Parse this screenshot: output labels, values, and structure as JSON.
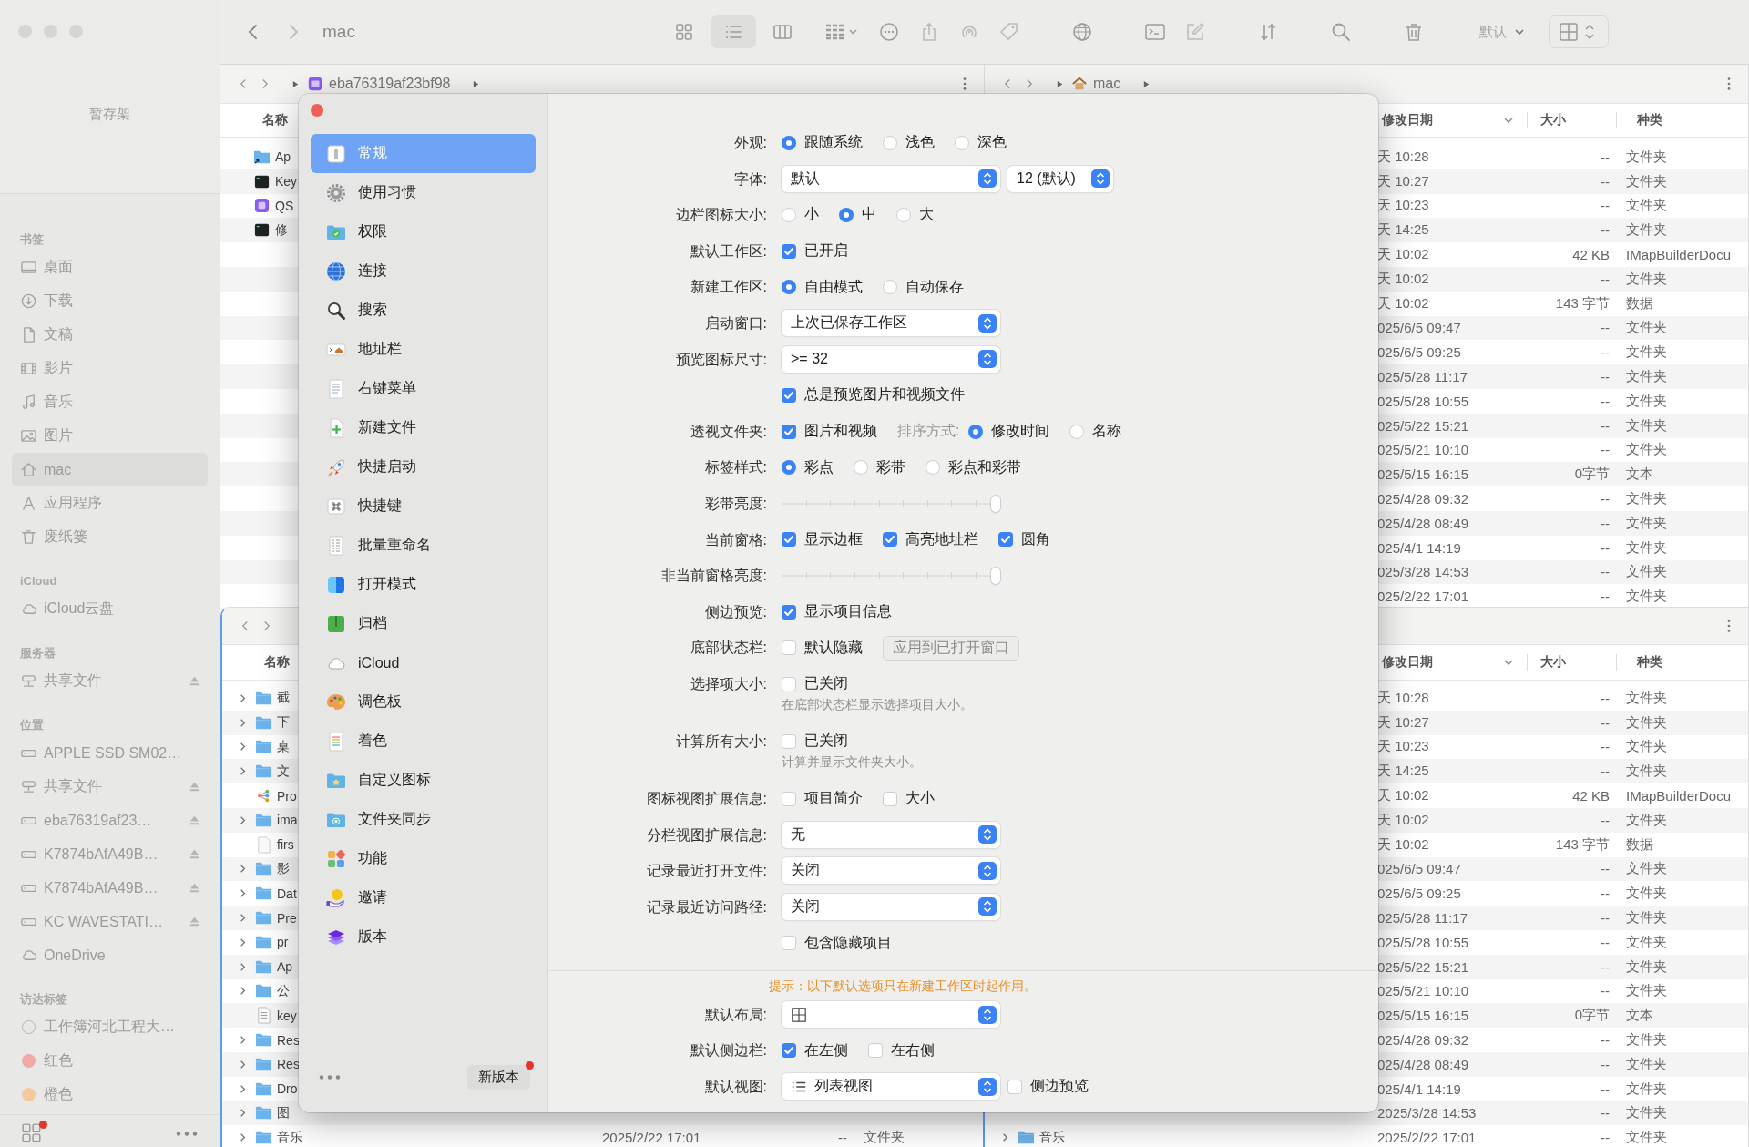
{
  "toolbar": {
    "title": "mac",
    "views": [
      {
        "kind": "icons",
        "selected": false
      },
      {
        "kind": "list",
        "selected": true
      },
      {
        "kind": "columns",
        "selected": false
      }
    ],
    "sort_label": "默认"
  },
  "sidebar": {
    "shelf": "暂存架",
    "badge": true,
    "sections": [
      {
        "title": "书签",
        "items": [
          {
            "label": "桌面",
            "kind": "desktop",
            "selected": false,
            "eject": false
          },
          {
            "label": "下载",
            "kind": "download",
            "selected": false,
            "eject": false
          },
          {
            "label": "文稿",
            "kind": "doc",
            "selected": false,
            "eject": false
          },
          {
            "label": "影片",
            "kind": "film",
            "selected": false,
            "eject": false
          },
          {
            "label": "音乐",
            "kind": "music",
            "selected": false,
            "eject": false
          },
          {
            "label": "图片",
            "kind": "picture",
            "selected": false,
            "eject": false
          },
          {
            "label": "mac",
            "kind": "home",
            "selected": true,
            "eject": false
          },
          {
            "label": "应用程序",
            "kind": "apps",
            "selected": false,
            "eject": false
          },
          {
            "label": "废纸篓",
            "kind": "trash",
            "selected": false,
            "eject": false
          }
        ]
      },
      {
        "title": "iCloud",
        "items": [
          {
            "label": "iCloud云盘",
            "kind": "cloud",
            "selected": false,
            "eject": false
          }
        ]
      },
      {
        "title": "服务器",
        "items": [
          {
            "label": "共享文件",
            "kind": "server",
            "selected": false,
            "eject": true
          }
        ]
      },
      {
        "title": "位置",
        "items": [
          {
            "label": "APPLE SSD SM02…",
            "kind": "drive",
            "selected": false,
            "eject": false
          },
          {
            "label": "共享文件",
            "kind": "server",
            "selected": false,
            "eject": true
          },
          {
            "label": "eba76319af23…",
            "kind": "drive",
            "selected": false,
            "eject": true
          },
          {
            "label": "K7874bAfA49B…",
            "kind": "drive",
            "selected": false,
            "eject": true
          },
          {
            "label": "K7874bAfA49B…",
            "kind": "drive",
            "selected": false,
            "eject": true
          },
          {
            "label": "KC WAVESTATI…",
            "kind": "drive",
            "selected": false,
            "eject": true
          },
          {
            "label": "OneDrive",
            "kind": "cloud",
            "selected": false,
            "eject": false
          }
        ]
      },
      {
        "title": "访达标签",
        "items": [
          {
            "label": "工作簿河北工程大…",
            "kind": "tag-empty",
            "selected": false,
            "eject": false
          },
          {
            "label": "红色",
            "kind": "tag",
            "color": "#f0a9a5",
            "selected": false,
            "eject": false
          },
          {
            "label": "橙色",
            "kind": "tag",
            "color": "#f5c9a0",
            "selected": false,
            "eject": false
          }
        ]
      }
    ]
  },
  "panes": [
    {
      "active": false,
      "path": {
        "kind": "app",
        "label": "eba76319af23bf98"
      },
      "columns": [
        "名称"
      ],
      "rows": [
        {
          "name": "Ap",
          "kind": "folder-alias",
          "expandable": false
        },
        {
          "name": "Key",
          "kind": "terminal",
          "expandable": false
        },
        {
          "name": "QS",
          "kind": "app",
          "expandable": false
        },
        {
          "name": "修",
          "kind": "terminal",
          "expandable": false
        }
      ]
    },
    {
      "active": false,
      "path": {
        "kind": "home",
        "label": "mac"
      },
      "columns": [
        "修改日期",
        "大小",
        "种类"
      ],
      "rows": [
        {
          "date": "天 10:28",
          "size": "--",
          "type": "文件夹"
        },
        {
          "date": "天 10:27",
          "size": "--",
          "type": "文件夹"
        },
        {
          "date": "天 10:23",
          "size": "--",
          "type": "文件夹"
        },
        {
          "date": "天 14:25",
          "size": "--",
          "type": "文件夹"
        },
        {
          "date": "天 10:02",
          "size": "42 KB",
          "type": "IMapBuilderDocu"
        },
        {
          "date": "天 10:02",
          "size": "--",
          "type": "文件夹"
        },
        {
          "date": "天 10:02",
          "size": "143 字节",
          "type": "数据"
        },
        {
          "date": "025/6/5 09:47",
          "size": "--",
          "type": "文件夹"
        },
        {
          "date": "025/6/5 09:25",
          "size": "--",
          "type": "文件夹"
        },
        {
          "date": "025/5/28 11:17",
          "size": "--",
          "type": "文件夹"
        },
        {
          "date": "025/5/28 10:55",
          "size": "--",
          "type": "文件夹"
        },
        {
          "date": "025/5/22 15:21",
          "size": "--",
          "type": "文件夹"
        },
        {
          "date": "025/5/21 10:10",
          "size": "--",
          "type": "文件夹"
        },
        {
          "date": "025/5/15 16:15",
          "size": "0字节",
          "type": "文本"
        },
        {
          "date": "025/4/28 09:32",
          "size": "--",
          "type": "文件夹"
        },
        {
          "date": "025/4/28 08:49",
          "size": "--",
          "type": "文件夹"
        },
        {
          "date": "025/4/1 14:19",
          "size": "--",
          "type": "文件夹"
        },
        {
          "date": "025/3/28 14:53",
          "size": "--",
          "type": "文件夹"
        },
        {
          "date": "025/2/22 17:01",
          "size": "--",
          "type": "文件夹"
        }
      ]
    },
    {
      "active": true,
      "columns": [
        "名称"
      ],
      "rows": [
        {
          "name": "截",
          "kind": "folder",
          "expandable": true
        },
        {
          "name": "下",
          "kind": "folder",
          "expandable": true
        },
        {
          "name": "桌",
          "kind": "folder",
          "expandable": true
        },
        {
          "name": "文",
          "kind": "folder",
          "expandable": true
        },
        {
          "name": "Pro",
          "kind": "graph",
          "expandable": false
        },
        {
          "name": "ima",
          "kind": "folder",
          "expandable": true
        },
        {
          "name": "firs",
          "kind": "file",
          "expandable": false
        },
        {
          "name": "影",
          "kind": "folder",
          "expandable": true
        },
        {
          "name": "Dat",
          "kind": "folder",
          "expandable": true
        },
        {
          "name": "Pre",
          "kind": "folder",
          "expandable": true
        },
        {
          "name": "pr",
          "kind": "folder",
          "expandable": true
        },
        {
          "name": "Ap",
          "kind": "folder",
          "expandable": true
        },
        {
          "name": "公",
          "kind": "folder",
          "expandable": true
        },
        {
          "name": "key",
          "kind": "text",
          "expandable": false
        },
        {
          "name": "Res",
          "kind": "folder",
          "expandable": true
        },
        {
          "name": "Res",
          "kind": "folder",
          "expandable": true
        },
        {
          "name": "Dro",
          "kind": "folder",
          "expandable": true
        },
        {
          "name": "图",
          "kind": "folder",
          "expandable": true
        },
        {
          "name": "音乐",
          "kind": "folder",
          "expandable": true,
          "date": "2025/2/22 17:01",
          "size": "--",
          "type": "文件夹"
        }
      ]
    },
    {
      "active": false,
      "columns": [
        "修改日期",
        "大小",
        "种类"
      ],
      "rows": [
        {
          "date": "天 10:28",
          "size": "--",
          "type": "文件夹"
        },
        {
          "date": "天 10:27",
          "size": "--",
          "type": "文件夹"
        },
        {
          "date": "天 10:23",
          "size": "--",
          "type": "文件夹"
        },
        {
          "date": "天 14:25",
          "size": "--",
          "type": "文件夹"
        },
        {
          "date": "天 10:02",
          "size": "42 KB",
          "type": "IMapBuilderDocu"
        },
        {
          "date": "天 10:02",
          "size": "--",
          "type": "文件夹"
        },
        {
          "date": "天 10:02",
          "size": "143 字节",
          "type": "数据"
        },
        {
          "date": "025/6/5 09:47",
          "size": "--",
          "type": "文件夹"
        },
        {
          "date": "025/6/5 09:25",
          "size": "--",
          "type": "文件夹"
        },
        {
          "date": "025/5/28 11:17",
          "size": "--",
          "type": "文件夹"
        },
        {
          "date": "025/5/28 10:55",
          "size": "--",
          "type": "文件夹"
        },
        {
          "date": "025/5/22 15:21",
          "size": "--",
          "type": "文件夹"
        },
        {
          "date": "025/5/21 10:10",
          "size": "--",
          "type": "文件夹"
        },
        {
          "date": "025/5/15 16:15",
          "size": "0字节",
          "type": "文本"
        },
        {
          "date": "025/4/28 09:32",
          "size": "--",
          "type": "文件夹"
        },
        {
          "date": "025/4/28 08:49",
          "size": "--",
          "type": "文件夹"
        },
        {
          "date": "025/4/1 14:19",
          "size": "--",
          "type": "文件夹"
        },
        {
          "date": "2025/3/28 14:53",
          "size": "--",
          "type": "文件夹"
        },
        {
          "name": "音乐",
          "kind": "folder",
          "expandable": true,
          "date": "2025/2/22 17:01",
          "size": "--",
          "type": "文件夹"
        }
      ]
    }
  ],
  "prefs": {
    "nav": [
      {
        "label": "常规",
        "kind": "general",
        "selected": true
      },
      {
        "label": "使用习惯",
        "kind": "habits",
        "selected": false
      },
      {
        "label": "权限",
        "kind": "permission",
        "selected": false
      },
      {
        "label": "连接",
        "kind": "connect",
        "selected": false
      },
      {
        "label": "搜索",
        "kind": "search",
        "selected": false
      },
      {
        "label": "地址栏",
        "kind": "address",
        "selected": false
      },
      {
        "label": "右键菜单",
        "kind": "menu",
        "selected": false
      },
      {
        "label": "新建文件",
        "kind": "newfile",
        "selected": false
      },
      {
        "label": "快捷启动",
        "kind": "launch",
        "selected": false
      },
      {
        "label": "快捷键",
        "kind": "shortcut",
        "selected": false
      },
      {
        "label": "批量重命名",
        "kind": "rename",
        "selected": false
      },
      {
        "label": "打开模式",
        "kind": "openmode",
        "selected": false
      },
      {
        "label": "归档",
        "kind": "archive",
        "selected": false
      },
      {
        "label": "iCloud",
        "kind": "icloud",
        "selected": false
      },
      {
        "label": "调色板",
        "kind": "palette",
        "selected": false
      },
      {
        "label": "着色",
        "kind": "coloring",
        "selected": false
      },
      {
        "label": "自定义图标",
        "kind": "customicon",
        "selected": false
      },
      {
        "label": "文件夹同步",
        "kind": "sync",
        "selected": false
      },
      {
        "label": "功能",
        "kind": "features",
        "selected": false
      },
      {
        "label": "邀请",
        "kind": "invite",
        "selected": false
      },
      {
        "label": "版本",
        "kind": "version",
        "selected": false
      }
    ],
    "new_version": {
      "label": "新版本",
      "badge": true
    },
    "rows": [
      {
        "label": "外观:",
        "controls": [
          {
            "kind": "radio",
            "label": "跟随系统",
            "selected": true
          },
          {
            "kind": "radio",
            "label": "浅色",
            "selected": false
          },
          {
            "kind": "radio",
            "label": "深色",
            "selected": false
          }
        ]
      },
      {
        "label": "字体:",
        "controls": [
          {
            "kind": "select",
            "value": "默认"
          },
          {
            "kind": "small-select",
            "value": "12 (默认)"
          }
        ]
      },
      {
        "label": "边栏图标大小:",
        "controls": [
          {
            "kind": "radio",
            "label": "小",
            "selected": false
          },
          {
            "kind": "radio",
            "label": "中",
            "selected": true
          },
          {
            "kind": "radio",
            "label": "大",
            "selected": false
          }
        ]
      },
      {
        "label": "默认工作区:",
        "controls": [
          {
            "kind": "checkbox",
            "label": "已开启",
            "checked": true
          }
        ]
      },
      {
        "label": "新建工作区:",
        "controls": [
          {
            "kind": "radio",
            "label": "自由模式",
            "selected": true
          },
          {
            "kind": "radio",
            "label": "自动保存",
            "selected": false
          }
        ]
      },
      {
        "label": "启动窗口:",
        "controls": [
          {
            "kind": "select",
            "value": "上次已保存工作区"
          }
        ]
      },
      {
        "label": "预览图标尺寸:",
        "controls": [
          {
            "kind": "select",
            "value": ">= 32"
          }
        ]
      },
      {
        "controls": [
          {
            "kind": "checkbox",
            "label": "总是预览图片和视频文件",
            "checked": true
          }
        ]
      },
      {
        "label": "透视文件夹:",
        "controls": [
          {
            "kind": "checkbox",
            "label": "图片和视频",
            "checked": true
          },
          {
            "kind": "label",
            "text": "排序方式:"
          },
          {
            "kind": "radio",
            "label": "修改时间",
            "selected": true
          },
          {
            "kind": "radio",
            "label": "名称",
            "selected": false
          }
        ]
      },
      {
        "label": "标签样式:",
        "controls": [
          {
            "kind": "radio",
            "label": "彩点",
            "selected": true
          },
          {
            "kind": "radio",
            "label": "彩带",
            "selected": false
          },
          {
            "kind": "radio",
            "label": "彩点和彩带",
            "selected": false
          }
        ]
      },
      {
        "label": "彩带亮度:",
        "controls": [
          {
            "kind": "slider",
            "level": 1
          }
        ]
      },
      {
        "label": "当前窗格:",
        "controls": [
          {
            "kind": "checkbox",
            "label": "显示边框",
            "checked": true
          },
          {
            "kind": "checkbox",
            "label": "高亮地址栏",
            "checked": true
          },
          {
            "kind": "checkbox",
            "label": "圆角",
            "checked": true
          }
        ]
      },
      {
        "label": "非当前窗格亮度:",
        "controls": [
          {
            "kind": "slider",
            "level": 1
          }
        ]
      },
      {
        "label": "侧边预览:",
        "controls": [
          {
            "kind": "checkbox",
            "label": "显示项目信息",
            "checked": true
          }
        ]
      },
      {
        "label": "底部状态栏:",
        "controls": [
          {
            "kind": "checkbox",
            "label": "默认隐藏",
            "checked": false
          },
          {
            "kind": "button",
            "label": "应用到已打开窗口",
            "disabled": true
          }
        ]
      },
      {
        "label": "选择项大小:",
        "controls": [
          {
            "kind": "checkbox",
            "label": "已关闭",
            "checked": false
          }
        ],
        "hint": "在底部状态栏显示选择项目大小。"
      },
      {
        "label": "计算所有大小:",
        "controls": [
          {
            "kind": "checkbox",
            "label": "已关闭",
            "checked": false
          }
        ],
        "hint": "计算并显示文件夹大小。"
      },
      {
        "label": "图标视图扩展信息:",
        "controls": [
          {
            "kind": "checkbox",
            "label": "项目简介",
            "checked": false
          },
          {
            "kind": "checkbox",
            "label": "大小",
            "checked": false
          }
        ]
      },
      {
        "label": "分栏视图扩展信息:",
        "controls": [
          {
            "kind": "select",
            "value": "无"
          }
        ]
      },
      {
        "label": "记录最近打开文件:",
        "controls": [
          {
            "kind": "select",
            "value": "关闭"
          }
        ]
      },
      {
        "label": "记录最近访问路径:",
        "controls": [
          {
            "kind": "select",
            "value": "关闭"
          }
        ]
      },
      {
        "controls": [
          {
            "kind": "checkbox",
            "label": "包含隐藏项目",
            "checked": false
          }
        ]
      }
    ],
    "notice": "提示：以下默认选项只在新建工作区时起作用。",
    "default_rows": [
      {
        "label": "默认布局:",
        "controls": [
          {
            "kind": "layout-select"
          }
        ]
      },
      {
        "label": "默认侧边栏:",
        "controls": [
          {
            "kind": "checkbox",
            "label": "在左侧",
            "checked": true
          },
          {
            "kind": "checkbox",
            "label": "在右侧",
            "checked": false
          }
        ]
      },
      {
        "label": "默认视图:",
        "controls": [
          {
            "kind": "list-select",
            "value": "列表视图"
          },
          {
            "kind": "checkbox",
            "label": "侧边预览",
            "checked": false
          }
        ]
      }
    ]
  }
}
